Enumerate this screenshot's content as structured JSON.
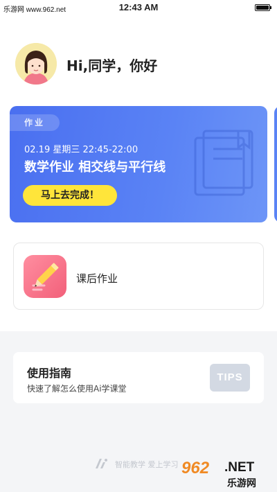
{
  "status_bar": {
    "left_text": "乐游网 www.962.net",
    "time": "12:43 AM",
    "battery_level": 1.0
  },
  "header": {
    "greeting": "Hi,同学，你好",
    "avatar_icon": "girl-avatar-icon"
  },
  "task_card": {
    "tag": "作业",
    "date": "02.19  星期三  22:45-22:00",
    "title": "数学作业 相交线与平行线",
    "button_label": "马上去完成！",
    "background_color": "#5079f2",
    "button_color": "#ffe53a"
  },
  "homework": {
    "label": "课后作业",
    "icon": "pencil-icon",
    "icon_color": "#f46b82"
  },
  "guide": {
    "title": "使用指南",
    "subtitle": "快速了解怎么使用Ai学课堂",
    "badge": "TIPS"
  },
  "footer": {
    "text": "智能教学 爱上学习"
  },
  "watermark": {
    "number": "962",
    "net": ".NET",
    "cn": "乐游网"
  }
}
